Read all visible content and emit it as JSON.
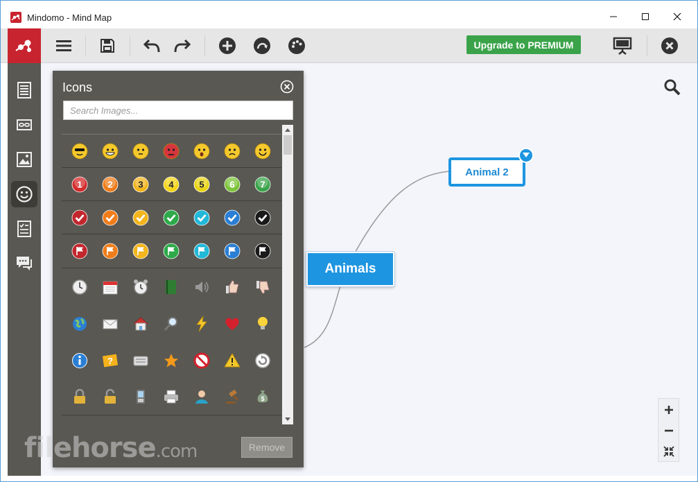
{
  "window": {
    "title": "Mindomo - Mind Map"
  },
  "toolbar": {
    "upgrade_label": "Upgrade to PREMIUM"
  },
  "panel": {
    "title": "Icons",
    "search_placeholder": "Search Images...",
    "remove_label": "Remove",
    "rows": [
      {
        "kind": "emoji",
        "items": [
          "cool",
          "grin",
          "smile",
          "angry",
          "surprised",
          "sad",
          "happy"
        ]
      },
      {
        "kind": "number",
        "items": [
          {
            "label": "1",
            "color": "#d42a2a"
          },
          {
            "label": "2",
            "color": "#f07d1a"
          },
          {
            "label": "3",
            "color": "#f2b51c"
          },
          {
            "label": "4",
            "color": "#f5d416"
          },
          {
            "label": "5",
            "color": "#e9d412"
          },
          {
            "label": "6",
            "color": "#7cc43a"
          },
          {
            "label": "7",
            "color": "#3aa34a"
          }
        ]
      },
      {
        "kind": "check",
        "items": [
          "#c1272d",
          "#f07d1a",
          "#f2b51c",
          "#2daa4a",
          "#22b8d8",
          "#2a7fd4",
          "#1a1a1a"
        ]
      },
      {
        "kind": "flag",
        "items": [
          "#c1272d",
          "#f07d1a",
          "#f2b51c",
          "#2daa4a",
          "#22b8d8",
          "#2a7fd4",
          "#1a1a1a"
        ]
      },
      {
        "kind": "misc",
        "items": [
          "clock",
          "calendar",
          "alarm-clock",
          "book",
          "speaker",
          "thumbs-up",
          "thumbs-down"
        ]
      },
      {
        "kind": "misc",
        "items": [
          "globe",
          "envelope",
          "home",
          "magnifier",
          "lightning",
          "heart",
          "light-bulb"
        ]
      },
      {
        "kind": "misc",
        "items": [
          "info",
          "help",
          "keyboard",
          "star",
          "no-entry",
          "warning",
          "refresh"
        ]
      },
      {
        "kind": "misc",
        "items": [
          "lock",
          "unlock",
          "mobile-phone",
          "printer",
          "user",
          "gavel",
          "money-bag"
        ]
      }
    ]
  },
  "map": {
    "central_topic": "Animals",
    "child_topic": "Animal 2"
  },
  "watermark": {
    "brand": "filehorse",
    "suffix": ".com"
  }
}
